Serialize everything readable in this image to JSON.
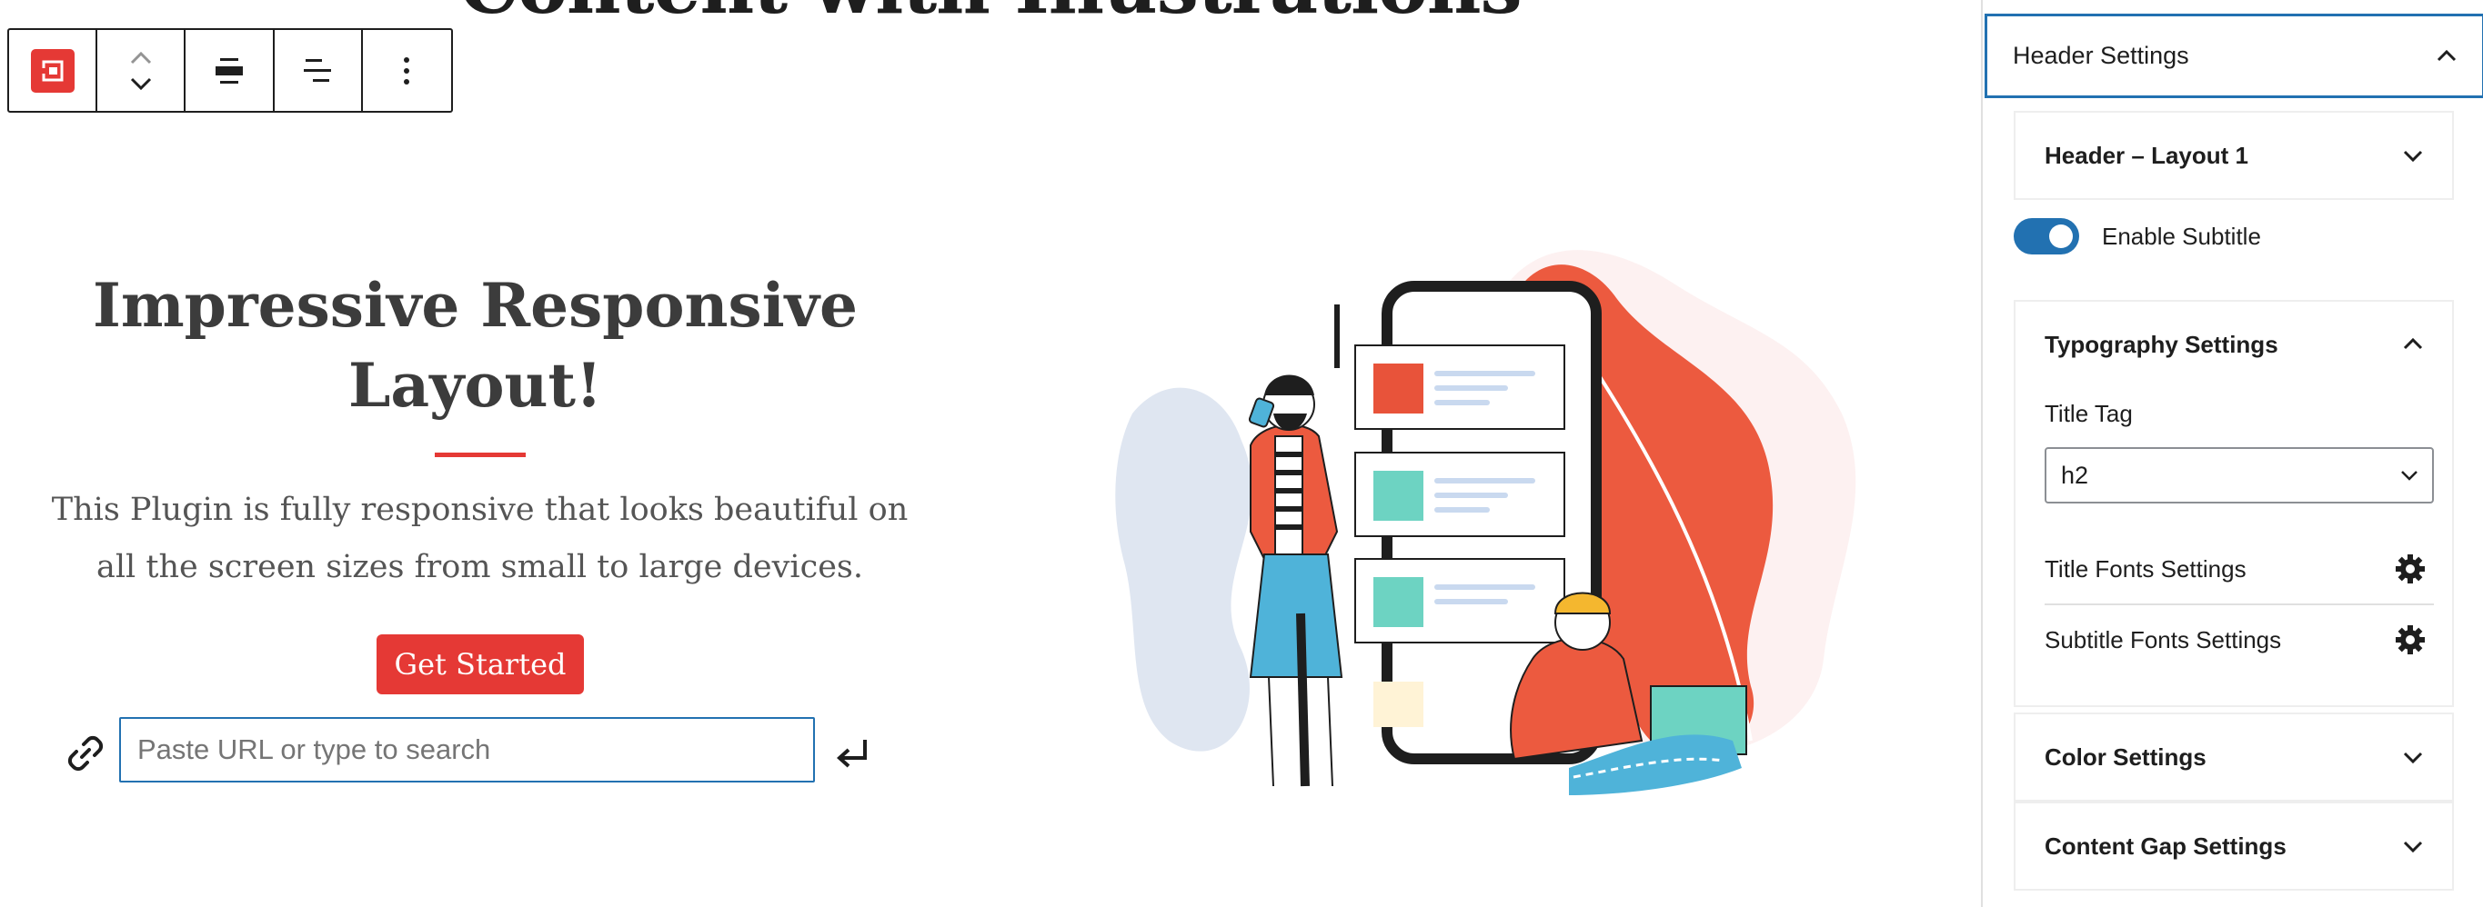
{
  "editor": {
    "top_heading": "Content with Illustrations",
    "toolbar": {
      "plugin_icon": "plugin-block-icon",
      "move_icon": "move-up-down-icon",
      "align_icon": "align-center-icon",
      "justify_icon": "justify-icon",
      "options_icon": "more-options-icon"
    },
    "block": {
      "title": "Impressive Responsive Layout!",
      "description": "This Plugin is fully responsive that looks beautiful on all the screen sizes from small to large devices.",
      "button_label": "Get Started",
      "accent_color": "#e53935"
    },
    "link_search": {
      "placeholder": "Paste URL or type to search",
      "value": "",
      "link_icon": "link-icon",
      "submit_icon": "enter-icon"
    },
    "illustration_alt": "people-with-phone-illustration"
  },
  "sidebar": {
    "header_settings": {
      "label": "Header Settings",
      "expanded": true
    },
    "layout_panel": {
      "label": "Header – Layout 1",
      "expanded": false
    },
    "enable_subtitle": {
      "label": "Enable Subtitle",
      "checked": true
    },
    "typography": {
      "label": "Typography Settings",
      "expanded": true,
      "title_tag_label": "Title Tag",
      "title_tag_value": "h2",
      "title_fonts_label": "Title Fonts Settings",
      "subtitle_fonts_label": "Subtitle Fonts Settings"
    },
    "color_settings": {
      "label": "Color Settings",
      "expanded": false
    },
    "content_gap_settings": {
      "label": "Content Gap Settings",
      "expanded": false
    },
    "accent_color": "#2271b1"
  }
}
